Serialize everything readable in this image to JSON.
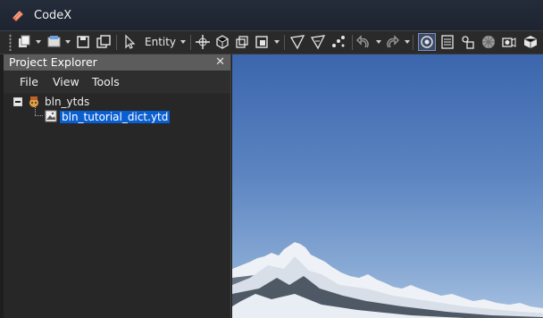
{
  "window": {
    "title": "CodeX"
  },
  "toolbar": {
    "entity_mode": "Entity",
    "icons": [
      "new-icon",
      "open-icon",
      "save-icon",
      "save-all-icon",
      "select-pointer-icon",
      "move-icon",
      "rotate-icon",
      "scale-icon",
      "snap-icon",
      "waypoint-icon",
      "waypoint-plus-icon",
      "nodes-icon",
      "undo-icon",
      "redo-icon",
      "render-icon",
      "wireframe-icon",
      "skeleton-icon",
      "texture-icon",
      "camera-icon",
      "box-icon"
    ]
  },
  "project_explorer": {
    "title": "Project Explorer",
    "menu": [
      "File",
      "View",
      "Tools"
    ],
    "tree": {
      "root": {
        "label": "bln_ytds",
        "expanded": true
      },
      "children": [
        {
          "label": "bln_tutorial_dict.ytd",
          "selected": true
        }
      ]
    }
  },
  "colors": {
    "selection": "#0a5fd0",
    "panel_header": "#5c5c5c",
    "sky_top": "#3b66ad"
  }
}
